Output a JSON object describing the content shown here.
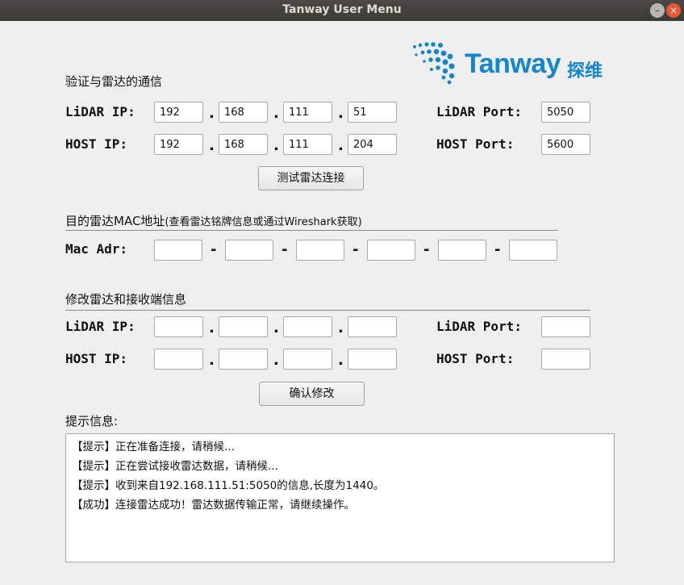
{
  "window": {
    "title": "Tanway User Menu",
    "min": "–",
    "close": "×"
  },
  "logo": {
    "brand": "Tanway",
    "brand_cn": "探维"
  },
  "connect": {
    "title": "验证与雷达的通信",
    "lidar_ip_label": "LiDAR IP:",
    "host_ip_label": "HOST IP:",
    "lidar_port_label": "LiDAR Port:",
    "host_port_label": "HOST Port:",
    "lidar_ip": [
      "192",
      "168",
      "111",
      "51"
    ],
    "host_ip": [
      "192",
      "168",
      "111",
      "204"
    ],
    "lidar_port": "5050",
    "host_port": "5600",
    "dot": ".",
    "test_button": "测试雷达连接"
  },
  "mac": {
    "title": "目的雷达MAC地址",
    "note": "(查看雷达铭牌信息或通过Wireshark获取)",
    "label": "Mac Adr:",
    "dash": "-",
    "values": [
      "",
      "",
      "",
      "",
      "",
      ""
    ]
  },
  "modify": {
    "title": "修改雷达和接收端信息",
    "lidar_ip_label": "LiDAR IP:",
    "host_ip_label": "HOST IP:",
    "lidar_port_label": "LiDAR Port:",
    "host_port_label": "HOST Port:",
    "lidar_ip": [
      "",
      "",
      "",
      ""
    ],
    "host_ip": [
      "",
      "",
      "",
      ""
    ],
    "lidar_port": "",
    "host_port": "",
    "confirm_button": "确认修改"
  },
  "log": {
    "title": "提示信息:",
    "lines": [
      "【提示】正在准备连接，请稍候...",
      "【提示】正在尝试接收雷达数据，请稍候...",
      "【提示】收到来自192.168.111.51:5050的信息,长度为1440。",
      "【成功】连接雷达成功！雷达数据传输正常，请继续操作。"
    ]
  }
}
